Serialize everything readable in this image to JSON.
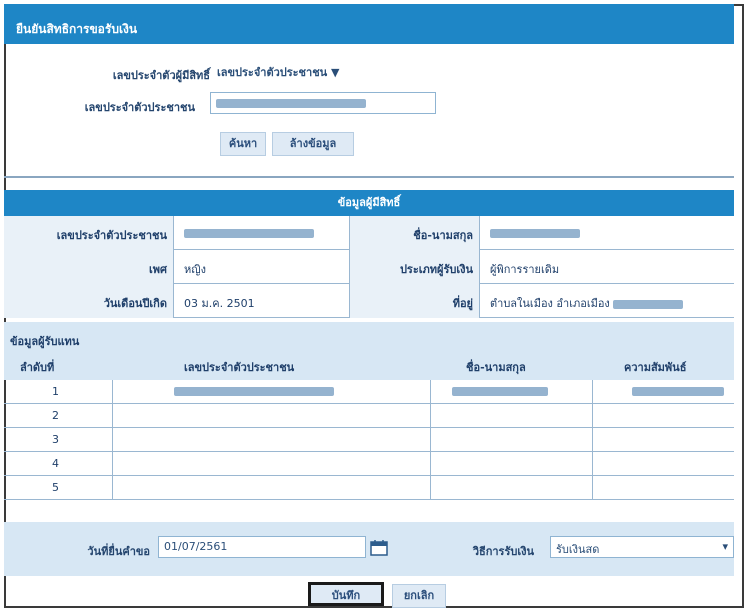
{
  "title": "ยืนยันสิทธิการขอรับเงิน",
  "search": {
    "field1_label": "เลขประจำตัวผู้มีสิทธิ์",
    "field1_value": "เลขประจำตัวประชาชน",
    "field2_label": "เลขประจำตัวประชาชน",
    "search_button": "ค้นหา",
    "clear_button": "ล้างข้อมูล"
  },
  "section_title": "ข้อมูลผู้มีสิทธิ์",
  "info": {
    "r1_l1": "เลขประจำตัวประชาชน",
    "r1_l2": "ชื่อ-นามสกุล",
    "r2_l1": "เพศ",
    "r2_v1": "หญิง",
    "r2_l2": "ประเภทผู้รับเงิน",
    "r2_v2": "ผู้พิการรายเดิม",
    "r3_l1": "วันเดือนปีเกิด",
    "r3_v1": "03 ม.ค. 2501",
    "r3_l2": "ที่อยู่",
    "r3_v2": "ตำบลในเมือง อำเภอเมือง"
  },
  "docs": {
    "title": "ข้อมูลผู้รับแทน",
    "col1": "ลำดับที่",
    "col2": "เลขประจำตัวประชาชน",
    "col3": "ชื่อ-นามสกุล",
    "col4": "ความสัมพันธ์",
    "rows": [
      "1",
      "2",
      "3",
      "4",
      "5"
    ]
  },
  "footer": {
    "date_label": "วันที่ยื่นคำขอ",
    "date_value": "01/07/2561",
    "method_label": "วิธีการรับเงิน",
    "method_value": "รับเงินสด"
  },
  "actions": {
    "save": "บันทึก",
    "cancel": "ยกเลิก"
  }
}
